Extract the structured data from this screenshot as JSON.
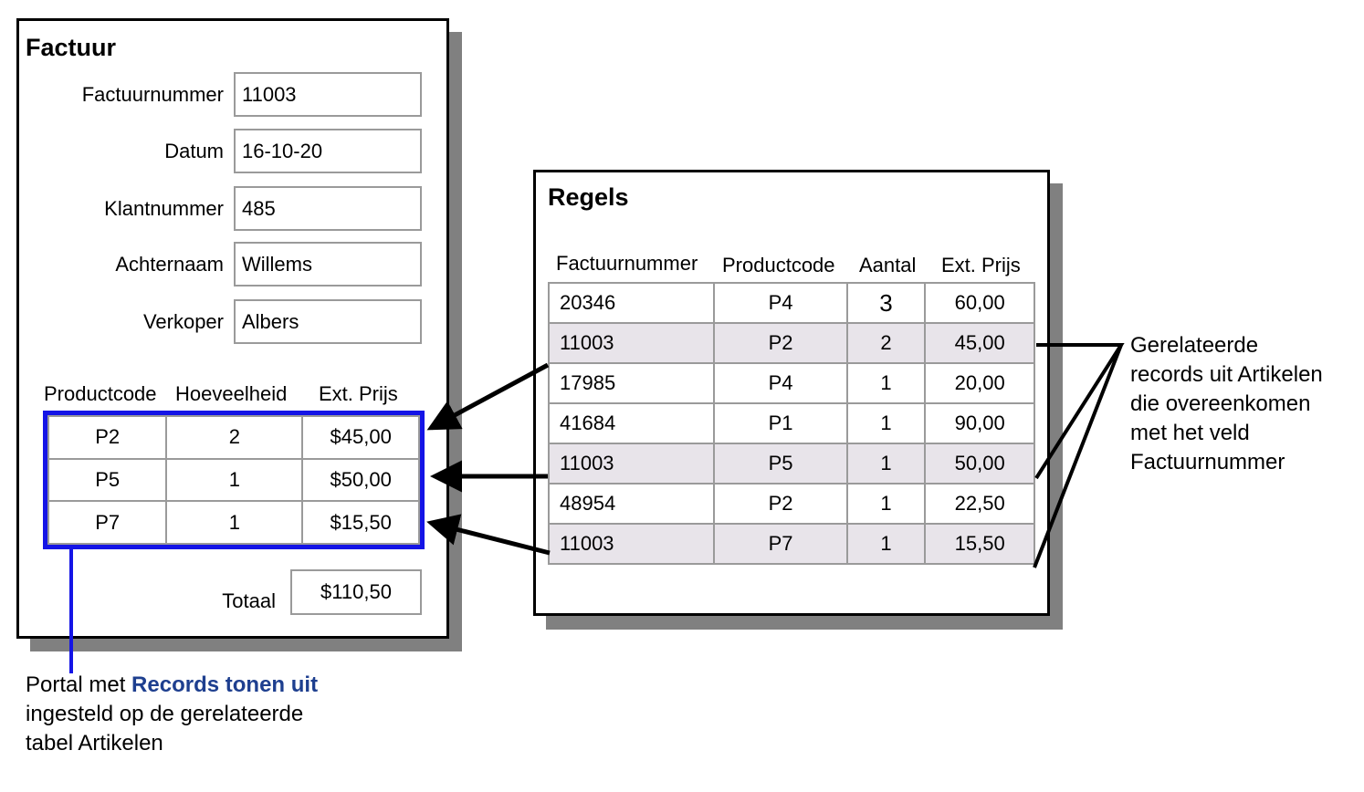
{
  "factuur": {
    "title": "Factuur",
    "fields": [
      {
        "label": "Factuurnummer",
        "value": "11003"
      },
      {
        "label": "Datum",
        "value": "16-10-20"
      },
      {
        "label": "Klantnummer",
        "value": "485"
      },
      {
        "label": "Achternaam",
        "value": "Willems"
      },
      {
        "label": "Verkoper",
        "value": "Albers"
      }
    ],
    "portal": {
      "headers": [
        "Productcode",
        "Hoeveelheid",
        "Ext. Prijs"
      ],
      "rows": [
        [
          "P2",
          "2",
          "$45,00"
        ],
        [
          "P5",
          "1",
          "$50,00"
        ],
        [
          "P7",
          "1",
          "$15,50"
        ]
      ],
      "border_color": "#1414e6"
    },
    "total_label": "Totaal",
    "total_value": "$110,50"
  },
  "regels": {
    "title": "Regels",
    "headers": [
      "Factuurnummer",
      "Productcode",
      "Aantal",
      "Ext. Prijs"
    ],
    "rows": [
      {
        "cells": [
          "20346",
          "P4",
          "3",
          "60,00"
        ],
        "highlight": false
      },
      {
        "cells": [
          "11003",
          "P2",
          "2",
          "45,00"
        ],
        "highlight": true
      },
      {
        "cells": [
          "17985",
          "P4",
          "1",
          "20,00"
        ],
        "highlight": false
      },
      {
        "cells": [
          "41684",
          "P1",
          "1",
          "90,00"
        ],
        "highlight": false
      },
      {
        "cells": [
          "11003",
          "P5",
          "1",
          "50,00"
        ],
        "highlight": true
      },
      {
        "cells": [
          "48954",
          "P2",
          "1",
          "22,50"
        ],
        "highlight": false
      },
      {
        "cells": [
          "11003",
          "P7",
          "1",
          "15,50"
        ],
        "highlight": true
      }
    ],
    "highlight_color": "#e8e4ea"
  },
  "callout_right": {
    "lines": [
      "Gerelateerde",
      "records uit Artikelen",
      "die overeenkomen",
      "met het veld",
      "Factuurnummer"
    ]
  },
  "callout_bottom": {
    "prefix": "Portal met ",
    "highlight": "Records tonen uit",
    "lines": [
      "ingesteld op de gerelateerde",
      "tabel Artikelen"
    ],
    "highlight_color": "#1e3f8f"
  }
}
